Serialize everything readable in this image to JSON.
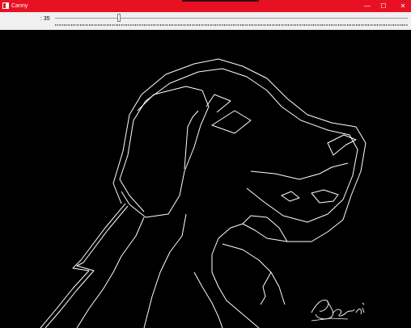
{
  "window": {
    "title": "Canny",
    "icon": "opencv-window-icon",
    "controls": [
      "minimize-icon",
      "maximize-icon",
      "close-icon"
    ],
    "minimize_glyph": "—",
    "maximize_glyph": "☐",
    "close_glyph": "✕",
    "accent_color": "#e81123"
  },
  "trackbar": {
    "label": ": 35",
    "value": 35
  },
  "canvas": {
    "background": "#000000",
    "edge_color": "#ffffff",
    "signature_text": "Bogdi"
  }
}
